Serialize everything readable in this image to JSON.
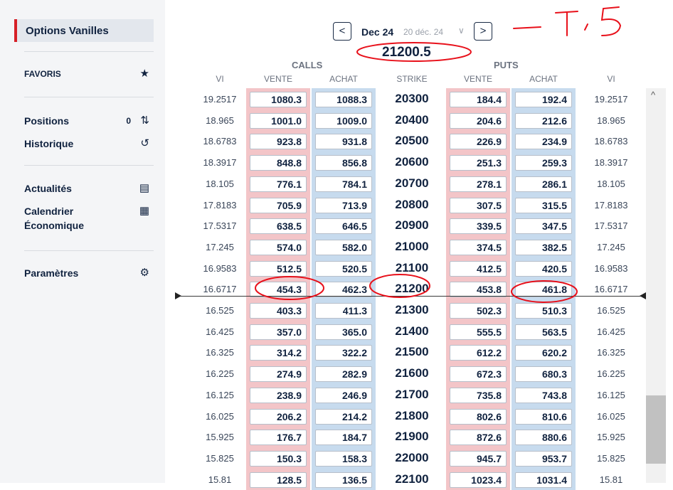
{
  "sidebar": {
    "active_item": "Options Vanilles",
    "favoris": "FAVORIS",
    "positions": "Positions",
    "positions_count": "0",
    "historique": "Historique",
    "actualites": "Actualités",
    "calendrier": "Calendrier",
    "economique": "Économique",
    "parametres": "Paramètres",
    "icons": [
      "star-icon",
      "swap-arrows-icon",
      "history-icon",
      "newspaper-icon",
      "calendar-icon",
      "gear-icon"
    ]
  },
  "header": {
    "prev": "<",
    "next": ">",
    "month": "Dec 24",
    "date": "20 déc. 24",
    "chevron": "∨",
    "spot": "21200.5",
    "calls": "CALLS",
    "puts": "PUTS",
    "columns": [
      "VI",
      "VENTE",
      "ACHAT",
      "STRIKE",
      "VENTE",
      "ACHAT",
      "VI"
    ]
  },
  "rows": [
    [
      "19.2517",
      "1080.3",
      "1088.3",
      "20300",
      "184.4",
      "192.4",
      "19.2517"
    ],
    [
      "18.965",
      "1001.0",
      "1009.0",
      "20400",
      "204.6",
      "212.6",
      "18.965"
    ],
    [
      "18.6783",
      "923.8",
      "931.8",
      "20500",
      "226.9",
      "234.9",
      "18.6783"
    ],
    [
      "18.3917",
      "848.8",
      "856.8",
      "20600",
      "251.3",
      "259.3",
      "18.3917"
    ],
    [
      "18.105",
      "776.1",
      "784.1",
      "20700",
      "278.1",
      "286.1",
      "18.105"
    ],
    [
      "17.8183",
      "705.9",
      "713.9",
      "20800",
      "307.5",
      "315.5",
      "17.8183"
    ],
    [
      "17.5317",
      "638.5",
      "646.5",
      "20900",
      "339.5",
      "347.5",
      "17.5317"
    ],
    [
      "17.245",
      "574.0",
      "582.0",
      "21000",
      "374.5",
      "382.5",
      "17.245"
    ],
    [
      "16.9583",
      "512.5",
      "520.5",
      "21100",
      "412.5",
      "420.5",
      "16.9583"
    ],
    [
      "16.6717",
      "454.3",
      "462.3",
      "21200",
      "453.8",
      "461.8",
      "16.6717"
    ],
    [
      "16.525",
      "403.3",
      "411.3",
      "21300",
      "502.3",
      "510.3",
      "16.525"
    ],
    [
      "16.425",
      "357.0",
      "365.0",
      "21400",
      "555.5",
      "563.5",
      "16.425"
    ],
    [
      "16.325",
      "314.2",
      "322.2",
      "21500",
      "612.2",
      "620.2",
      "16.325"
    ],
    [
      "16.225",
      "274.9",
      "282.9",
      "21600",
      "672.3",
      "680.3",
      "16.225"
    ],
    [
      "16.125",
      "238.9",
      "246.9",
      "21700",
      "735.8",
      "743.8",
      "16.125"
    ],
    [
      "16.025",
      "206.2",
      "214.2",
      "21800",
      "802.6",
      "810.6",
      "16.025"
    ],
    [
      "15.925",
      "176.7",
      "184.7",
      "21900",
      "872.6",
      "880.6",
      "15.925"
    ],
    [
      "15.825",
      "150.3",
      "158.3",
      "22000",
      "945.7",
      "953.7",
      "15.825"
    ],
    [
      "15.81",
      "128.5",
      "136.5",
      "22100",
      "1023.4",
      "1031.4",
      "15.81"
    ]
  ],
  "annotation": {
    "handwritten_text": "- 7, 5",
    "color": "#e8101a"
  },
  "colors": {
    "accent": "#d62027",
    "calls_bg": "#f3c5c8",
    "puts_bg": "#c7dbee"
  }
}
